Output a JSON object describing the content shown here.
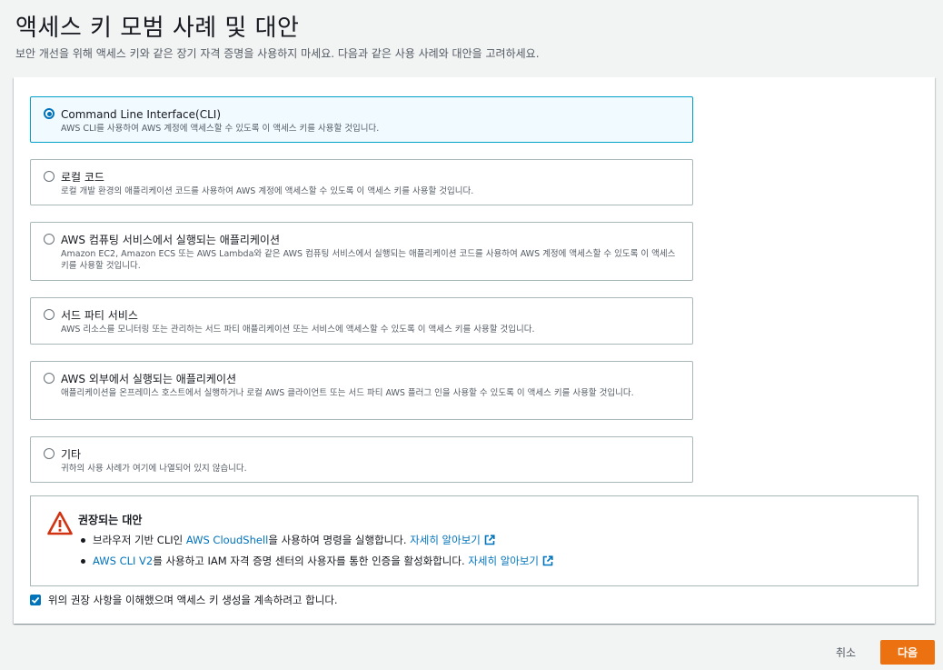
{
  "header": {
    "title": "액세스 키 모범 사례 및 대안",
    "subtitle": "보안 개선을 위해 액세스 키와 같은 장기 자격 증명을 사용하지 마세요. 다음과 같은 사용 사례와 대안을 고려하세요."
  },
  "options": [
    {
      "label": "Command Line Interface(CLI)",
      "desc": "AWS CLI를 사용하여 AWS 계정에 액세스할 수 있도록 이 액세스 키를 사용할 것입니다.",
      "selected": true
    },
    {
      "label": "로컬 코드",
      "desc": "로컬 개발 환경의 애플리케이션 코드를 사용하여 AWS 계정에 액세스할 수 있도록 이 액세스 키를 사용할 것입니다.",
      "selected": false
    },
    {
      "label": "AWS 컴퓨팅 서비스에서 실행되는 애플리케이션",
      "desc": "Amazon EC2, Amazon ECS 또는 AWS Lambda와 같은 AWS 컴퓨팅 서비스에서 실행되는 애플리케이션 코드를 사용하여 AWS 계정에 액세스할 수 있도록 이 액세스 키를 사용할 것입니다.",
      "selected": false
    },
    {
      "label": "서드 파티 서비스",
      "desc": "AWS 리소스를 모니터링 또는 관리하는 서드 파티 애플리케이션 또는 서비스에 액세스할 수 있도록 이 액세스 키를 사용할 것입니다.",
      "selected": false
    },
    {
      "label": "AWS 외부에서 실행되는 애플리케이션",
      "desc": "애플리케이션을 온프레미스 호스트에서 실행하거나 로컬 AWS 클라이언트 또는 서드 파티 AWS 플러그 인을 사용할 수 있도록 이 액세스 키를 사용할 것입니다.",
      "selected": false
    },
    {
      "label": "기타",
      "desc": "귀하의 사용 사례가 여기에 나열되어 있지 않습니다.",
      "selected": false
    }
  ],
  "alert": {
    "title": "권장되는 대안",
    "item1": {
      "prefix": "브라우저 기반 CLI인 ",
      "link": "AWS CloudShell",
      "suffix": "을 사용하여 명령을 실행합니다. ",
      "learn_more": "자세히 알아보기"
    },
    "item2": {
      "link": "AWS CLI V2",
      "suffix": "를 사용하고 IAM 자격 증명 센터의 사용자를 통한 인증을 활성화합니다. ",
      "learn_more": "자세히 알아보기"
    }
  },
  "acknowledge": {
    "label": "위의 권장 사항을 이해했으며 액세스 키 생성을 계속하려고 합니다.",
    "checked": true
  },
  "footer": {
    "cancel_label": "취소",
    "next_label": "다음"
  },
  "colors": {
    "primary_button": "#ec7211",
    "link": "#0073bb",
    "warning": "#d13212"
  }
}
